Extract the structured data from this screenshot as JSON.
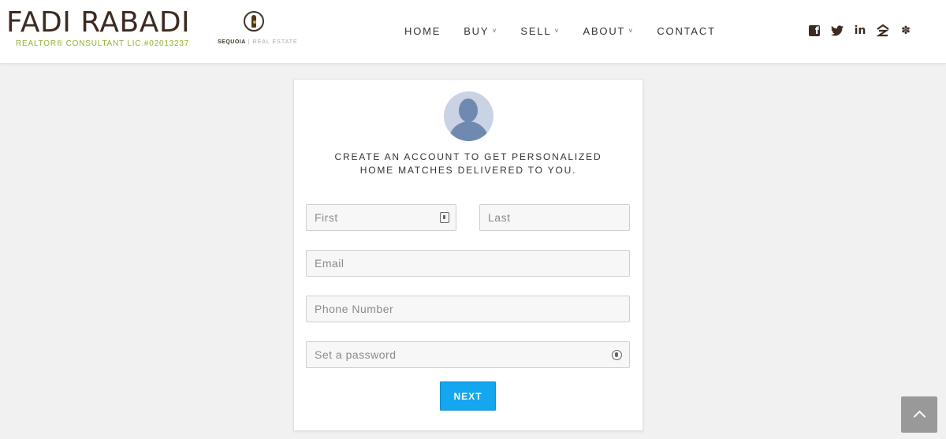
{
  "brand": {
    "name": "FADI RABADI",
    "subtitle": "REALTOR® CONSULTANT LIC.#02013237",
    "partner": "SEQUOIA",
    "partner_sub": "REAL ESTATE"
  },
  "nav": {
    "items": [
      {
        "label": "HOME",
        "dropdown": false
      },
      {
        "label": "BUY",
        "dropdown": true
      },
      {
        "label": "SELL",
        "dropdown": true
      },
      {
        "label": "ABOUT",
        "dropdown": true
      },
      {
        "label": "CONTACT",
        "dropdown": false
      }
    ],
    "chevron": "˅"
  },
  "social": {
    "icons": [
      "facebook-icon",
      "twitter-icon",
      "linkedin-icon",
      "zillow-icon",
      "yelp-icon"
    ],
    "glyphs": {
      "facebook": "f",
      "twitter": "🐦",
      "linkedin": "in",
      "zillow": "Z",
      "yelp": "✽"
    }
  },
  "signup": {
    "heading_line1": "CREATE AN ACCOUNT TO GET PERSONALIZED",
    "heading_line2": "HOME MATCHES DELIVERED TO YOU.",
    "first_placeholder": "First",
    "last_placeholder": "Last",
    "email_placeholder": "Email",
    "phone_placeholder": "Phone Number",
    "password_placeholder": "Set a password",
    "next_label": "NEXT"
  },
  "colors": {
    "brand": "#3d2b22",
    "accent_green": "#8cb32a",
    "button_blue": "#14a6ee",
    "avatar_bg": "#c9d3e3",
    "avatar_fg": "#6f89b0"
  }
}
